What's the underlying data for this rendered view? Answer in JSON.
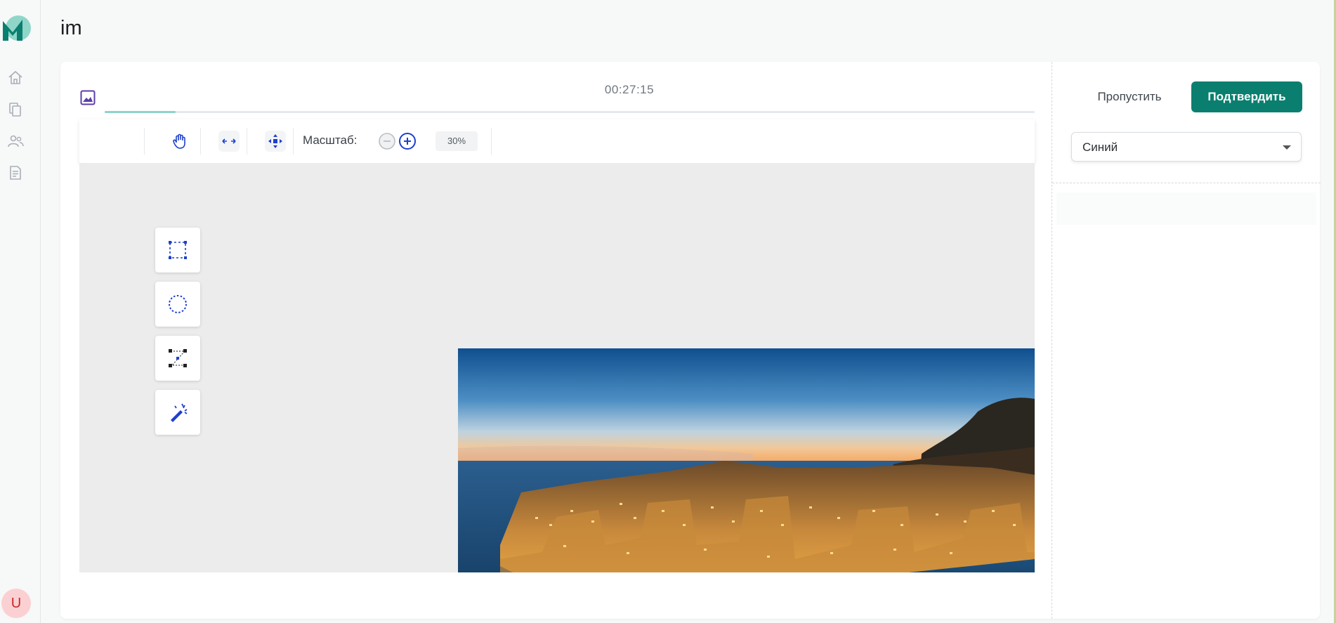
{
  "page": {
    "title": "im"
  },
  "nav": {
    "items": [
      {
        "name": "home",
        "icon": "home-icon"
      },
      {
        "name": "documents",
        "icon": "copy-icon"
      },
      {
        "name": "users",
        "icon": "users-icon"
      },
      {
        "name": "reports",
        "icon": "document-icon"
      }
    ],
    "avatar_initial": "U"
  },
  "task": {
    "timer": "00:27:15",
    "progress": 0.076
  },
  "toolbar": {
    "tools": [
      "hand-icon",
      "arrows-horizontal-icon",
      "move-icon"
    ],
    "zoom_label": "Масштаб:",
    "zoom_value": "30%"
  },
  "annotation_tools": [
    "rectangle-icon",
    "circle-icon",
    "polygon-icon",
    "magic-wand-icon"
  ],
  "panel": {
    "skip_label": "Пропустить",
    "confirm_label": "Подтвердить",
    "selected_class": "Синий"
  },
  "colors": {
    "brand": "#0b7f6f",
    "progress": "#8fd2cc",
    "tool_blue": "#1e3fcf",
    "avatar_bg": "#fbd0d3"
  }
}
